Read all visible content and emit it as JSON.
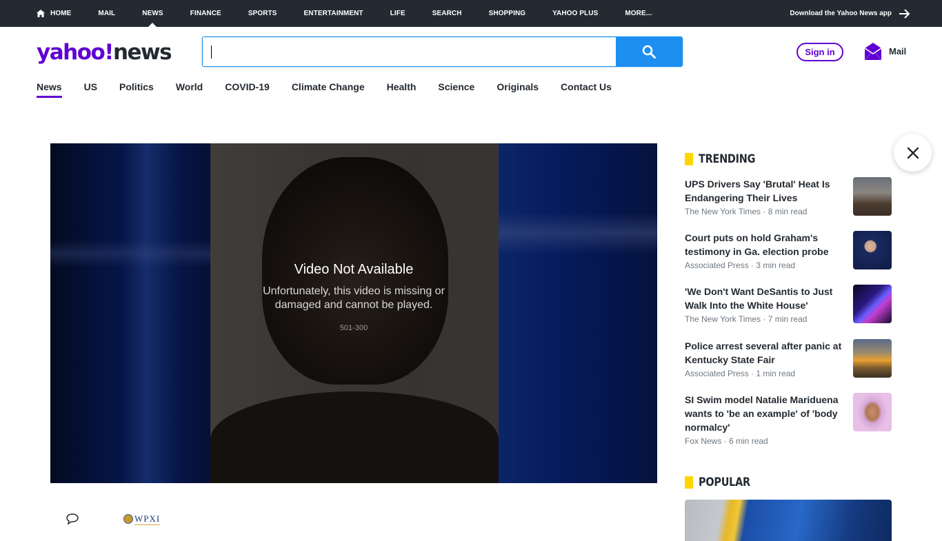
{
  "topnav": {
    "items": [
      {
        "label": "HOME",
        "icon": "home-icon"
      },
      {
        "label": "MAIL"
      },
      {
        "label": "NEWS",
        "active": true
      },
      {
        "label": "FINANCE"
      },
      {
        "label": "SPORTS"
      },
      {
        "label": "ENTERTAINMENT"
      },
      {
        "label": "LIFE"
      },
      {
        "label": "SEARCH"
      },
      {
        "label": "SHOPPING"
      },
      {
        "label": "YAHOO PLUS"
      },
      {
        "label": "MORE..."
      }
    ],
    "download_app": "Download the Yahoo News app"
  },
  "header": {
    "logo_yahoo": "yahoo!",
    "logo_news": "news",
    "search_value": "",
    "sign_in": "Sign in",
    "mail": "Mail"
  },
  "subnav": {
    "items": [
      "News",
      "US",
      "Politics",
      "World",
      "COVID-19",
      "Climate Change",
      "Health",
      "Science",
      "Originals",
      "Contact Us"
    ],
    "active": "News"
  },
  "video": {
    "title": "Video Not Available",
    "message_line1": "Unfortunately, this video is missing or",
    "message_line2": "damaged and cannot be played.",
    "code": "501-300"
  },
  "source": {
    "logo_text": "WPXI"
  },
  "trending": {
    "heading": "TRENDING",
    "items": [
      {
        "title": "UPS Drivers Say 'Brutal' Heat Is Endangering Their Lives",
        "source": "The New York Times",
        "read": "8 min read"
      },
      {
        "title": "Court puts on hold Graham's testimony in Ga. election probe",
        "source": "Associated Press",
        "read": "3 min read"
      },
      {
        "title": "'We Don't Want DeSantis to Just Walk Into the White House'",
        "source": "The New York Times",
        "read": "7 min read"
      },
      {
        "title": "Police arrest several after panic at Kentucky State Fair",
        "source": "Associated Press",
        "read": "1 min read"
      },
      {
        "title": "SI Swim model Natalie Mariduena wants to 'be an example' of 'body normalcy'",
        "source": "Fox News",
        "read": "6 min read"
      }
    ]
  },
  "popular": {
    "heading": "POPULAR"
  },
  "colors": {
    "brand_purple": "#6001d2",
    "search_blue": "#1d8ff0",
    "top_bar": "#232a31",
    "trending_bar": "#ffd600"
  }
}
